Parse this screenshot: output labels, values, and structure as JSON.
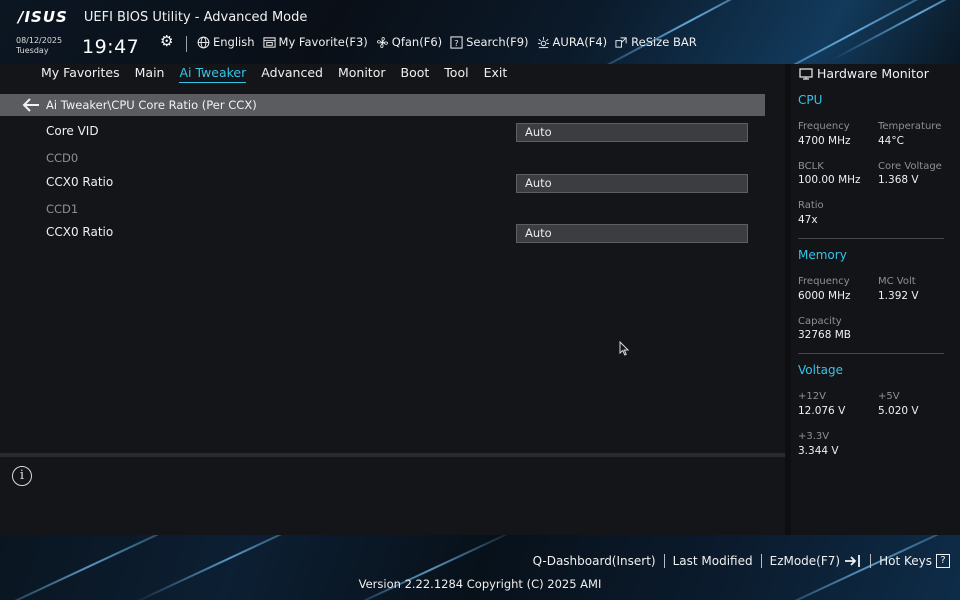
{
  "header": {
    "logo": "/ISUS",
    "title": "UEFI BIOS Utility - Advanced Mode",
    "date": "08/12/2025",
    "weekday": "Tuesday",
    "time": "19:47",
    "toolbar": [
      {
        "label": "English",
        "icon": "globe-icon"
      },
      {
        "label": "My Favorite(F3)",
        "icon": "favorite-icon"
      },
      {
        "label": "Qfan(F6)",
        "icon": "fan-icon"
      },
      {
        "label": "Search(F9)",
        "icon": "search-icon"
      },
      {
        "label": "AURA(F4)",
        "icon": "aura-icon"
      },
      {
        "label": "ReSize BAR",
        "icon": "resize-bar-icon"
      }
    ]
  },
  "nav": {
    "tabs": [
      "My Favorites",
      "Main",
      "Ai Tweaker",
      "Advanced",
      "Monitor",
      "Boot",
      "Tool",
      "Exit"
    ],
    "active": "Ai Tweaker"
  },
  "main": {
    "breadcrumb": "Ai Tweaker\\CPU Core Ratio (Per CCX)",
    "settings": {
      "core_vid": {
        "label": "Core VID",
        "value": "Auto"
      },
      "ccd0": "CCD0",
      "ccd0_ccx0": {
        "label": "CCX0 Ratio",
        "value": "Auto"
      },
      "ccd1": "CCD1",
      "ccd1_ccx0": {
        "label": "CCX0 Ratio",
        "value": "Auto"
      }
    }
  },
  "hardware_monitor": {
    "title": "Hardware Monitor",
    "cpu": {
      "heading": "CPU",
      "frequency_label": "Frequency",
      "frequency": "4700 MHz",
      "temperature_label": "Temperature",
      "temperature": "44°C",
      "bclk_label": "BCLK",
      "bclk": "100.00 MHz",
      "core_voltage_label": "Core Voltage",
      "core_voltage": "1.368 V",
      "ratio_label": "Ratio",
      "ratio": "47x"
    },
    "memory": {
      "heading": "Memory",
      "frequency_label": "Frequency",
      "frequency": "6000 MHz",
      "mc_volt_label": "MC Volt",
      "mc_volt": "1.392 V",
      "capacity_label": "Capacity",
      "capacity": "32768 MB"
    },
    "voltage": {
      "heading": "Voltage",
      "v12_label": "+12V",
      "v12": "12.076 V",
      "v5_label": "+5V",
      "v5": "5.020 V",
      "v33_label": "+3.3V",
      "v33": "3.344 V"
    }
  },
  "footer": {
    "q_dashboard": "Q-Dashboard(Insert)",
    "last_modified": "Last Modified",
    "ezmode": "EzMode(F7)",
    "hot_keys": "Hot Keys",
    "hot_keys_badge": "?",
    "version": "Version 2.22.1284 Copyright (C) 2025 AMI"
  },
  "colors": {
    "accent": "#36c3e8",
    "panel": "#141518",
    "breadcrumb_bar": "#5a5c60",
    "select_bg": "#3b3d41"
  }
}
